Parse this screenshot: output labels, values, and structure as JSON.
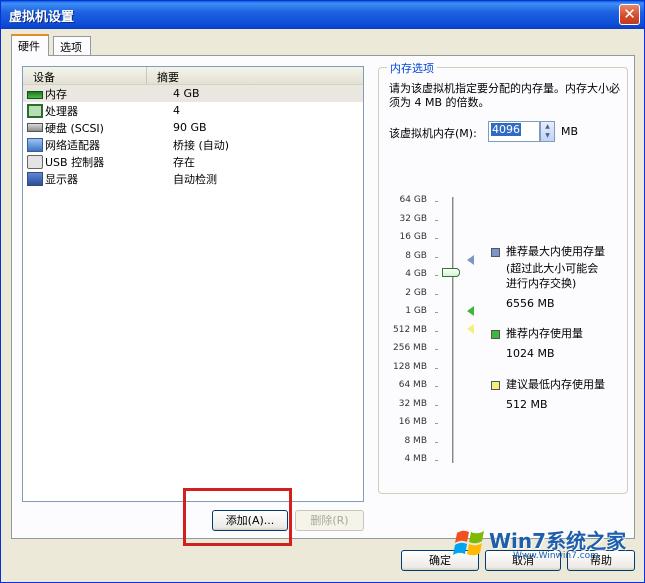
{
  "window": {
    "title": "虚拟机设置",
    "close_glyph": "✕"
  },
  "tabs": [
    {
      "label": "硬件"
    },
    {
      "label": "选项"
    }
  ],
  "device_list": {
    "headers": [
      "设备",
      "摘要"
    ],
    "rows": [
      {
        "name": "内存",
        "summary": "4 GB",
        "icon": "memory-icon"
      },
      {
        "name": "处理器",
        "summary": "4",
        "icon": "cpu-icon"
      },
      {
        "name": "硬盘 (SCSI)",
        "summary": "90 GB",
        "icon": "hard-disk-icon"
      },
      {
        "name": "网络适配器",
        "summary": "桥接 (自动)",
        "icon": "network-adapter-icon"
      },
      {
        "name": "USB 控制器",
        "summary": "存在",
        "icon": "usb-icon"
      },
      {
        "name": "显示器",
        "summary": "自动检测",
        "icon": "display-icon"
      }
    ]
  },
  "buttons": {
    "add": "添加(A)...",
    "remove": "删除(R)",
    "ok": "确定",
    "cancel": "取消",
    "help": "帮助"
  },
  "memory": {
    "group_title": "内存选项",
    "description": "请为该虚拟机指定要分配的内存量。内存大小必须为 4 MB 的倍数。",
    "field_label": "该虚拟机内存(M):",
    "value": "4096",
    "unit": "MB",
    "scale_labels": [
      "64 GB",
      "32 GB",
      "16 GB",
      "8 GB",
      "4 GB",
      "2 GB",
      "1 GB",
      "512 MB",
      "256 MB",
      "128 MB",
      "64 MB",
      "32 MB",
      "16 MB",
      "8 MB",
      "4 MB"
    ],
    "legend": [
      {
        "title": "推荐最大内使用存量",
        "note": "(超过此大小可能会进行内存交换)",
        "value": "6556 MB",
        "color": "#7c95c9"
      },
      {
        "title": "推荐内存使用量",
        "note": "",
        "value": "1024 MB",
        "color": "#3cb83c"
      },
      {
        "title": "建议最低内存使用量",
        "note": "",
        "value": "512 MB",
        "color": "#f5f07a"
      }
    ]
  },
  "watermark": {
    "text": "Win7系统之家",
    "url": "Www.Winwin7.com"
  }
}
